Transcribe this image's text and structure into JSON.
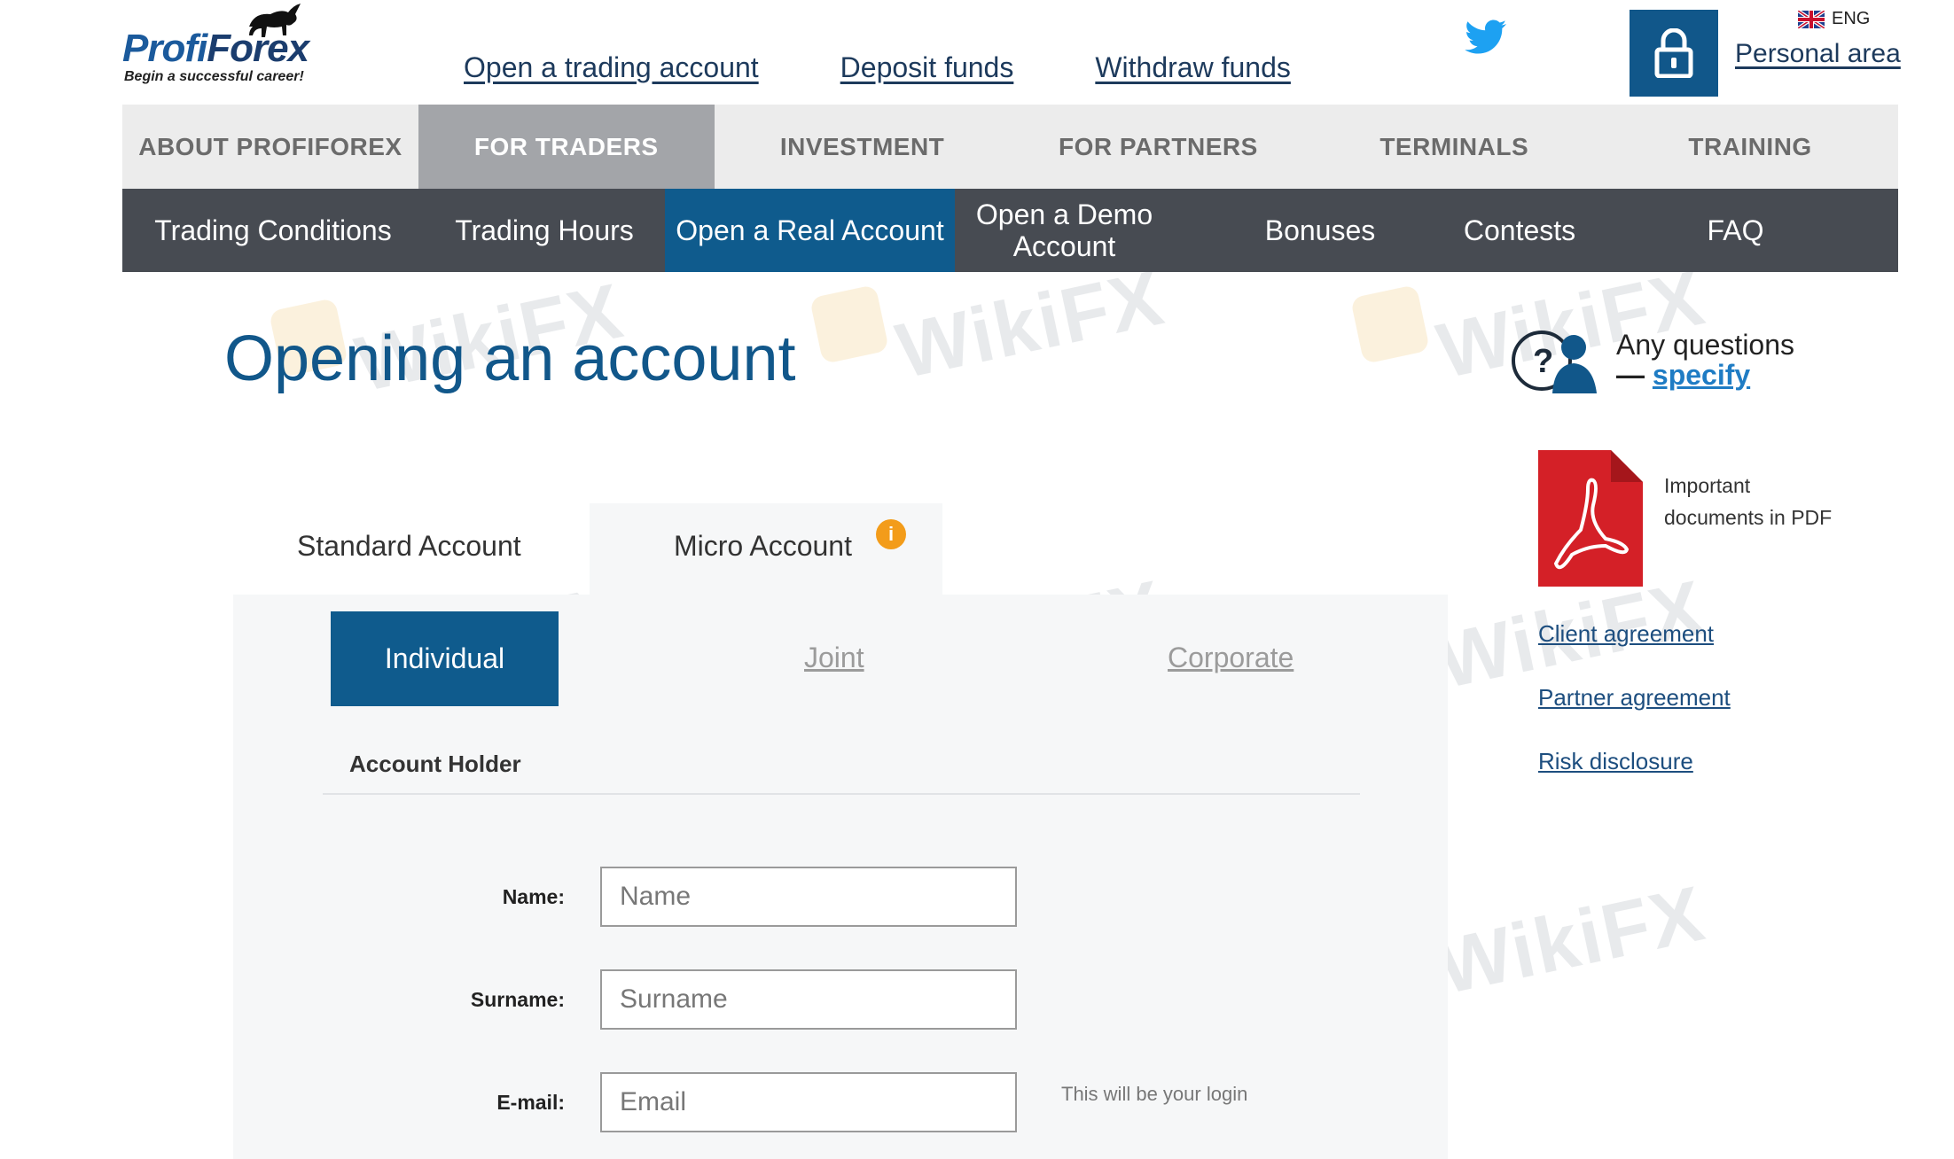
{
  "brand": {
    "name_part1": "Profi",
    "name_part2": "Forex",
    "tagline": "Begin a successful career!"
  },
  "header": {
    "links": [
      "Open a trading account",
      "Deposit funds",
      "Withdraw funds"
    ],
    "language": "ENG",
    "personal_area": "Personal area"
  },
  "main_nav": {
    "items": [
      "ABOUT PROFIFOREX",
      "FOR TRADERS",
      "INVESTMENT",
      "FOR PARTNERS",
      "TERMINALS",
      "TRAINING"
    ],
    "active": "FOR TRADERS"
  },
  "sub_nav": {
    "items": [
      "Trading Conditions",
      "Trading Hours",
      "Open a Real Account",
      "Open a Demo Account",
      "Bonuses",
      "Contests",
      "FAQ"
    ],
    "active": "Open a Real Account"
  },
  "page": {
    "title": "Opening an account"
  },
  "questions": {
    "line1": "Any questions",
    "dash": "—",
    "link": "specify"
  },
  "account_tabs": {
    "standard": "Standard Account",
    "micro": "Micro Account",
    "info_badge": "i"
  },
  "holder_type": {
    "individual": "Individual",
    "joint": "Joint",
    "corporate": "Corporate"
  },
  "form": {
    "section_title": "Account Holder",
    "name_label": "Name:",
    "name_placeholder": "Name",
    "surname_label": "Surname:",
    "surname_placeholder": "Surname",
    "email_label": "E-mail:",
    "email_placeholder": "Email",
    "email_hint": "This will be your login"
  },
  "docs": {
    "pdf_caption": "Important documents in PDF",
    "links": [
      "Client agreement",
      "Partner agreement",
      "Risk disclosure"
    ]
  },
  "watermark": {
    "text": "WikiFX"
  },
  "colors": {
    "primary": "#11578a",
    "active_nav": "#a3a5a9",
    "sub_nav_bg": "#474b52",
    "info_badge": "#f39c1a",
    "pdf_red": "#d42027"
  }
}
